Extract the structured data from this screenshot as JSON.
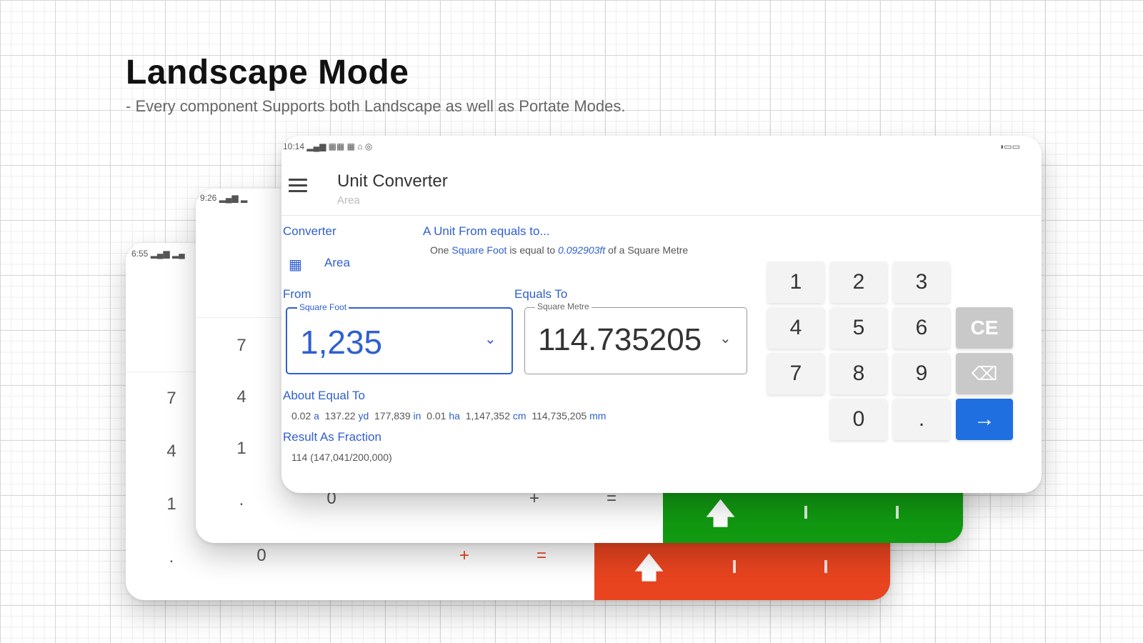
{
  "header": {
    "title": "Landscape Mode",
    "subtitle": "- Every component Supports both Landscape as well as Portate Modes."
  },
  "back_card": {
    "status_time": "6:55",
    "status_icons": "▂▄▆ ▂▄",
    "keys": [
      "7",
      "4",
      "1",
      ".",
      "0",
      "+",
      "="
    ],
    "accent_color": "#e8441f",
    "arrow_icon": "up-arrow-icon"
  },
  "mid_card": {
    "status_time": "9:26",
    "status_icons": "▂▄▆ ▂",
    "keys": [
      "7",
      "4",
      "1",
      ".",
      "0",
      "+",
      "="
    ],
    "accent_color": "#119911",
    "arrow_icon": "up-arrow-icon"
  },
  "front_card": {
    "status_time": "10:14",
    "status_icons": "▂▄▆ ▦▦ ▦ ⌂ ◎",
    "battery": "◑▭▭",
    "app_title": "Unit Converter",
    "app_subtitle": "Area",
    "converter_label": "Converter",
    "category_label": "Area",
    "info_title": "A Unit From equals to...",
    "info_line": {
      "p1": "One",
      "from_unit": "Square Foot",
      "p2": "is equal to",
      "value": "0.092903ft",
      "p3": "of a Square Metre"
    },
    "from_label": "From",
    "equals_label": "Equals To",
    "from_field": {
      "legend": "Square Foot",
      "value": "1,235"
    },
    "to_field": {
      "legend": "Square Metre",
      "value": "114.735205"
    },
    "about_label": "About Equal To",
    "about_values": [
      {
        "num": "0.02",
        "unit": "a"
      },
      {
        "num": "137.22",
        "unit": "yd"
      },
      {
        "num": "177,839",
        "unit": "in"
      },
      {
        "num": "0.01",
        "unit": "ha"
      },
      {
        "num": "1,147,352",
        "unit": "cm"
      },
      {
        "num": "114,735,205",
        "unit": "mm"
      }
    ],
    "fraction_label": "Result As Fraction",
    "fraction_value": "114  (147,041/200,000)",
    "keypad": {
      "k1": "1",
      "k2": "2",
      "k3": "3",
      "k4": "4",
      "k5": "5",
      "k6": "6",
      "k7": "7",
      "k8": "8",
      "k9": "9",
      "k0": "0",
      "kdot": ".",
      "clear": "CE",
      "backspace": "⌫",
      "enter": "→"
    },
    "accent_color": "#1f6fe0"
  }
}
